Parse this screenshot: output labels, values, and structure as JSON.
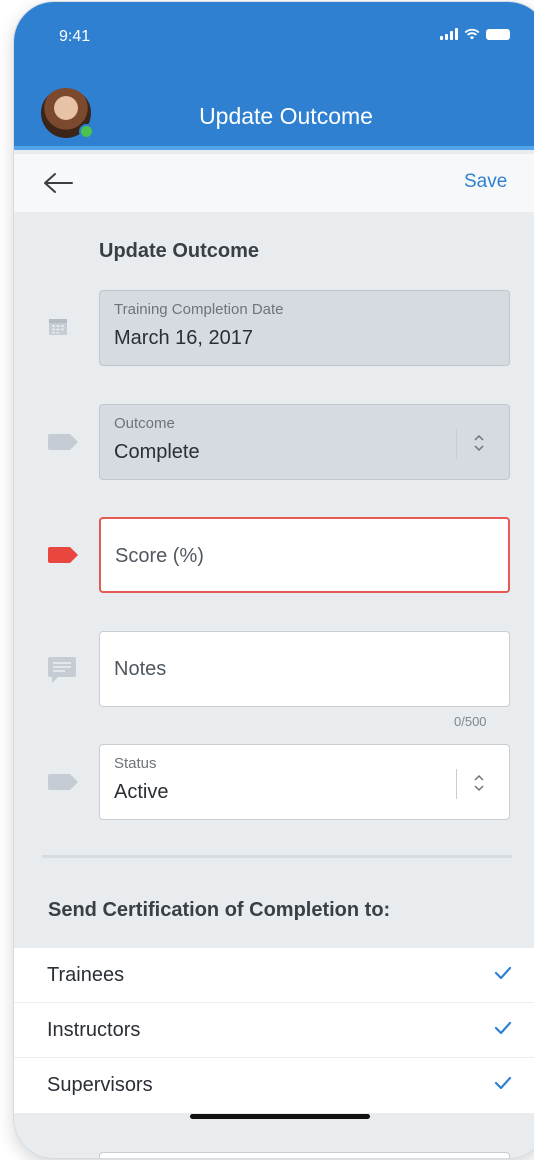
{
  "status_bar": {
    "time": "9:41"
  },
  "header": {
    "title": "Update Outcome"
  },
  "navbar": {
    "save_label": "Save"
  },
  "form": {
    "section_title": "Update Outcome",
    "completion_date": {
      "label": "Training Completion Date",
      "value": "March 16, 2017"
    },
    "outcome": {
      "label": "Outcome",
      "value": "Complete"
    },
    "score": {
      "placeholder": "Score (%)"
    },
    "notes": {
      "placeholder": "Notes",
      "counter": "0/500"
    },
    "status": {
      "label": "Status",
      "value": "Active"
    }
  },
  "certification": {
    "title": "Send Certification of Completion to:",
    "items": [
      {
        "label": "Trainees",
        "checked": true
      },
      {
        "label": "Instructors",
        "checked": true
      },
      {
        "label": "Supervisors",
        "checked": true
      }
    ]
  },
  "colors": {
    "header_blue": "#2f80d1",
    "accent_blue": "#2f80d1",
    "error_red": "#e8463e",
    "online_green": "#4cc24e"
  }
}
